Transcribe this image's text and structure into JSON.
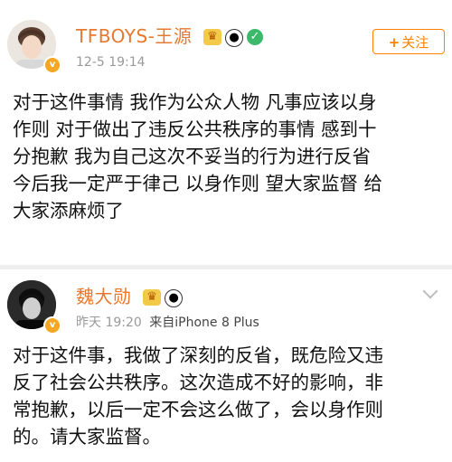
{
  "post1": {
    "username": "TFBOYS-王源",
    "timestamp": "12-5 19:14",
    "follow_label": "关注",
    "follow_plus": "+",
    "verified_mark": "v",
    "lines": [
      "对于这件事情 我作为公众人物 凡事应该以身",
      "作则 对于做出了违反公共秩序的事情 感到十",
      "分抱歉 我为自己这次不妥当的行为进行反省",
      "今后我一定严于律己 以身作则 望大家监督 给",
      "大家添麻烦了"
    ]
  },
  "post2": {
    "username": "魏大勋",
    "timestamp": "昨天 19:20",
    "source": "来自iPhone 8 Plus",
    "verified_mark": "v",
    "lines": [
      "对于这件事，我做了深刻的反省，既危险又违",
      "反了社会公共秩序。这次造成不好的影响，非",
      "常抱歉，以后一定不会这么做了，会以身作则",
      "的。请大家监督。"
    ]
  },
  "colors": {
    "username": "#e8782f",
    "follow": "#ff8200",
    "meta": "#9a9a9a",
    "divider": "#efefef"
  },
  "icons": [
    "avatar",
    "verified-badge-icon",
    "crown-icon",
    "panda-icon",
    "green-badge-icon",
    "chevron-down-icon"
  ]
}
